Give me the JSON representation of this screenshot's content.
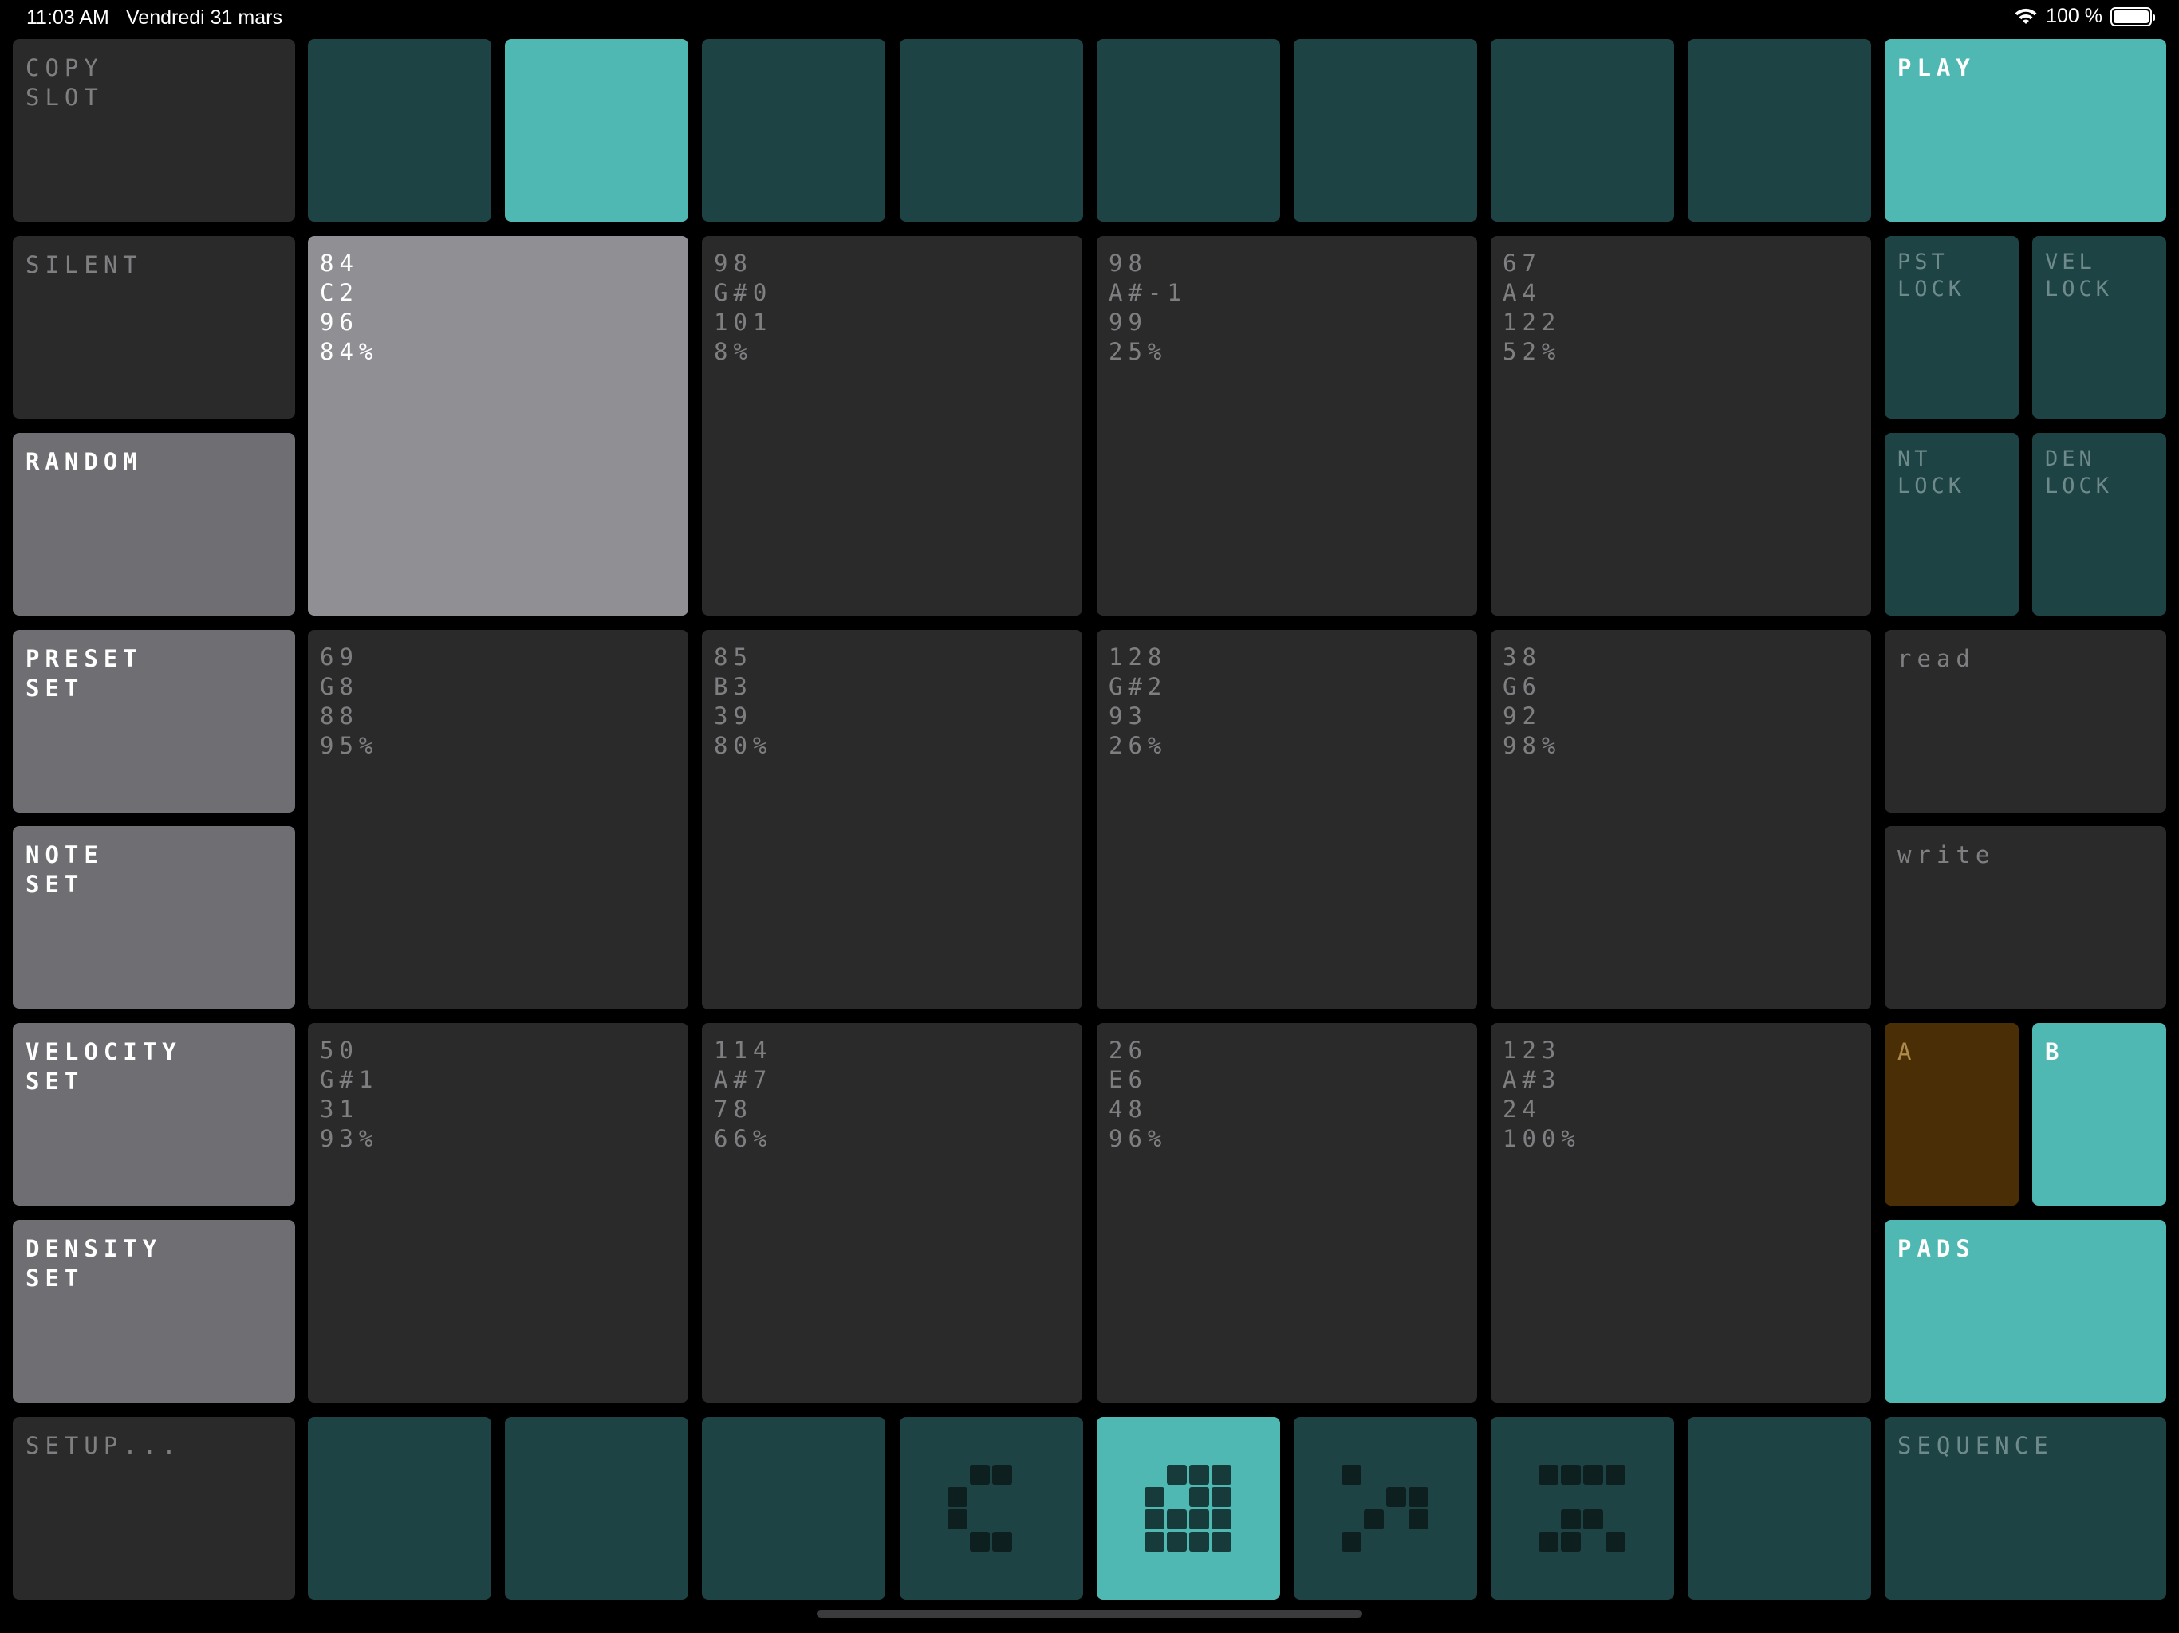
{
  "status_bar": {
    "time": "11:03 AM",
    "date": "Vendredi 31 mars",
    "battery": "100 %"
  },
  "left_column": {
    "copy_slot": "COPY\nSLOT",
    "silent": "SILENT",
    "random": "RANDOM",
    "preset_set": "PRESET\nSET",
    "note_set": "NOTE\nSET",
    "velocity_set": "VELOCITY\nSET",
    "density_set": "DENSITY\nSET",
    "setup": "SETUP..."
  },
  "right_column": {
    "play": "PLAY",
    "pst_lock": "PST\nLOCK",
    "vel_lock": "VEL\nLOCK",
    "nt_lock": "NT\nLOCK",
    "den_lock": "DEN\nLOCK",
    "read": "read",
    "write": "write",
    "a": "A",
    "b": "B",
    "pads": "PADS",
    "sequence": "SEQUENCE"
  },
  "top_slots": {
    "active_index": 1,
    "count": 8
  },
  "pads": [
    {
      "preset": "84",
      "note": "C2",
      "velocity": "96",
      "density": "84%"
    },
    {
      "preset": "98",
      "note": "G#0",
      "velocity": "101",
      "density": "8%"
    },
    {
      "preset": "98",
      "note": "A#-1",
      "velocity": "99",
      "density": "25%"
    },
    {
      "preset": "67",
      "note": "A4",
      "velocity": "122",
      "density": "52%"
    },
    {
      "preset": "69",
      "note": "G8",
      "velocity": "88",
      "density": "95%"
    },
    {
      "preset": "85",
      "note": "B3",
      "velocity": "39",
      "density": "80%"
    },
    {
      "preset": "128",
      "note": "G#2",
      "velocity": "93",
      "density": "26%"
    },
    {
      "preset": "38",
      "note": "G6",
      "velocity": "92",
      "density": "98%"
    },
    {
      "preset": "50",
      "note": "G#1",
      "velocity": "31",
      "density": "93%"
    },
    {
      "preset": "114",
      "note": "A#7",
      "velocity": "78",
      "density": "66%"
    },
    {
      "preset": "26",
      "note": "E6",
      "velocity": "48",
      "density": "96%"
    },
    {
      "preset": "123",
      "note": "A#3",
      "velocity": "24",
      "density": "100%"
    }
  ],
  "bottom_steps": {
    "active_index": 4,
    "glyph_icons": [
      "step-pattern-1-icon",
      "step-pattern-2-icon",
      "step-pattern-3-icon",
      "step-pattern-4-icon"
    ]
  },
  "colors": {
    "background": "#000000",
    "tile_dark": "#2a2a2b",
    "tile_grey": "#6f6e72",
    "tile_selected": "#908f94",
    "teal_dark": "#1e4344",
    "teal_active": "#4fb8b3",
    "brown_a": "#4a2f06"
  }
}
